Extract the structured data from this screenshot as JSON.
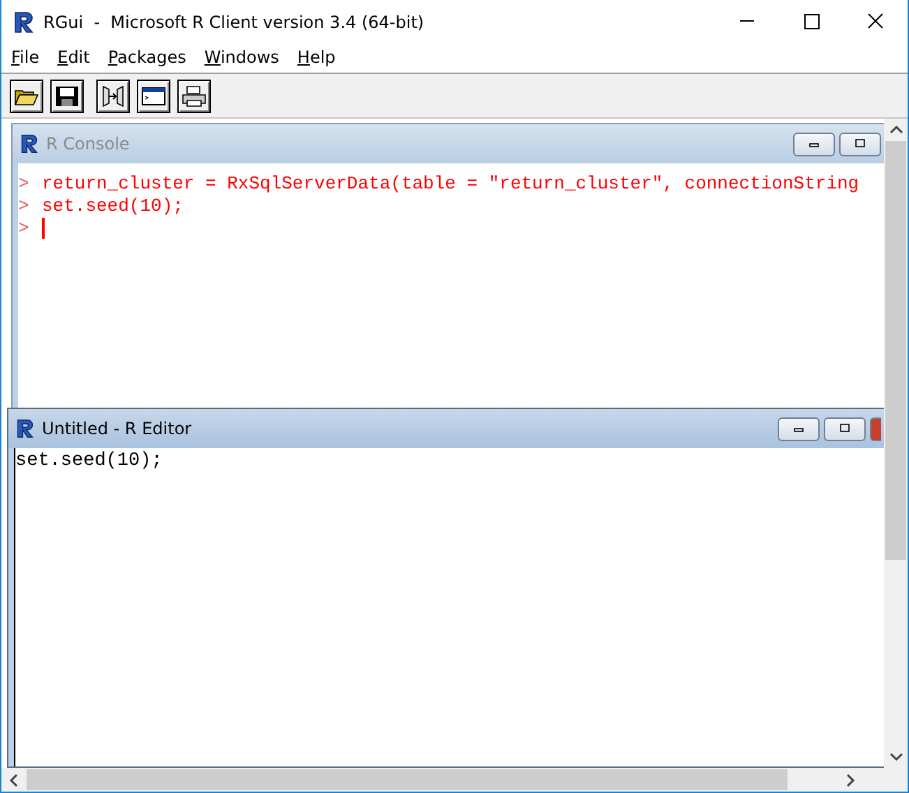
{
  "window": {
    "title": "RGui  -  Microsoft R Client version 3.4 (64-bit)"
  },
  "menu": [
    {
      "label": "File"
    },
    {
      "label": "Edit"
    },
    {
      "label": "Packages"
    },
    {
      "label": "Windows"
    },
    {
      "label": "Help"
    }
  ],
  "toolbar": [
    {
      "kind": "open"
    },
    {
      "kind": "save"
    },
    {
      "kind": "load"
    },
    {
      "kind": "console"
    },
    {
      "kind": "print"
    }
  ],
  "console": {
    "title": "R Console",
    "active": false,
    "lines": [
      {
        "prompt": ">",
        "code": "return_cluster = RxSqlServerData(table = \"return_cluster\", connectionString"
      },
      {
        "prompt": ">",
        "code": "set.seed(10);"
      }
    ],
    "input_prompt": ">"
  },
  "editor": {
    "title": "Untitled - R Editor",
    "active": true,
    "text": "set.seed(10);"
  }
}
